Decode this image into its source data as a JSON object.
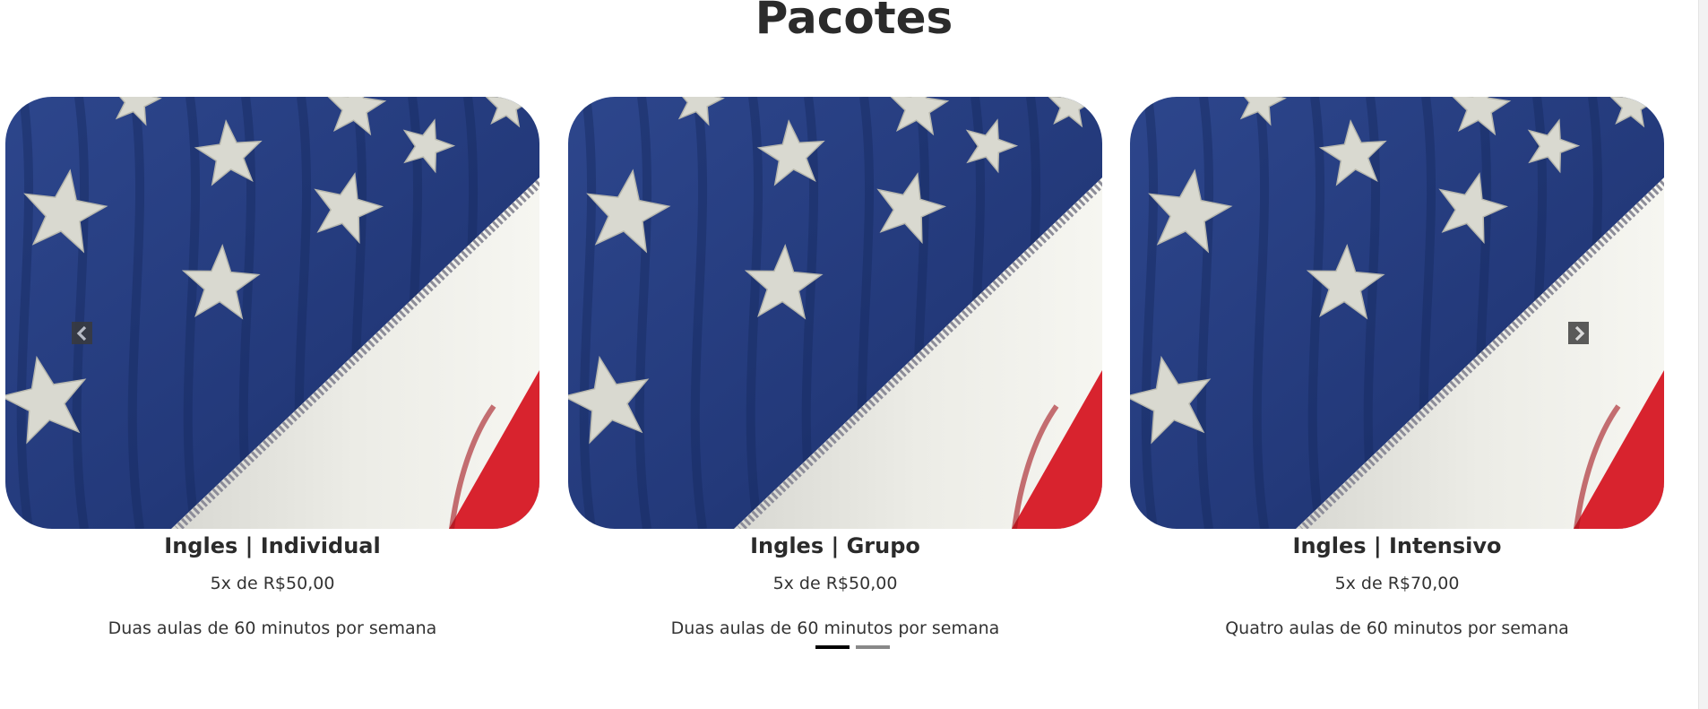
{
  "section": {
    "title": "Pacotes"
  },
  "packages": [
    {
      "title": "Ingles | Individual",
      "price": "5x de R$50,00",
      "description": "Duas aulas de 60 minutos por semana"
    },
    {
      "title": "Ingles | Grupo",
      "price": "5x de R$50,00",
      "description": "Duas aulas de 60 minutos por semana"
    },
    {
      "title": "Ingles | Intensivo",
      "price": "5x de R$70,00",
      "description": "Quatro aulas de 60 minutos por semana"
    }
  ],
  "carousel": {
    "prev_icon": "chevron-left-icon",
    "next_icon": "chevron-right-icon",
    "indicators": [
      {
        "active": true
      },
      {
        "active": false
      }
    ]
  },
  "colors": {
    "flag_blue": "#23397a",
    "flag_white": "#ecece6",
    "flag_red": "#d8232e",
    "star": "#d9d9d0",
    "indicator_active": "#000000",
    "indicator_inactive": "#888888"
  }
}
